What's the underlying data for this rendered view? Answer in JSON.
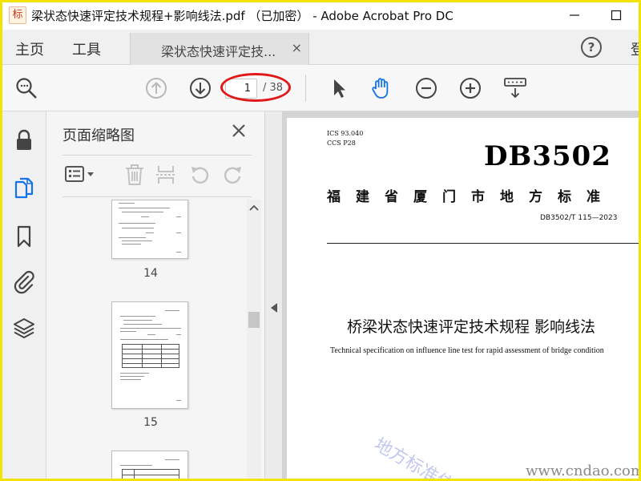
{
  "window": {
    "app_icon_glyph": "标",
    "title": "梁状态快速评定技术规程+影响线法.pdf （已加密） - Adobe Acrobat Pro DC",
    "minimize_icon": "minimize-icon",
    "maximize_icon": "maximize-icon"
  },
  "tabs": {
    "home": "主页",
    "tools": "工具",
    "document": "梁状态快速评定技...",
    "document_close": "×",
    "help": "?",
    "signin_partial": "登"
  },
  "toolbar": {
    "current_page": "1",
    "total_pages": "/ 38"
  },
  "thumbnails_panel": {
    "title": "页面缩略图",
    "pages": [
      {
        "label": "14"
      },
      {
        "label": "15"
      },
      {
        "label": ""
      }
    ]
  },
  "document": {
    "ics_line1": "ICS  93.040",
    "ics_line2": "CCS  P28",
    "code": "DB3502",
    "standard_name": "福建省厦门市地方标准",
    "standard_number": "DB3502/T 115—2023",
    "title_zh": "桥梁状态快速评定技术规程 影响线法",
    "title_en": "Technical specification on influence line test for rapid assessment of bridge condition"
  },
  "watermark": {
    "diagonal_text": "地方标准信",
    "site": "www.cndao.com"
  },
  "colors": {
    "frame_yellow": "#f2e400",
    "annotation_red": "#e01818",
    "active_blue": "#1473e6"
  }
}
